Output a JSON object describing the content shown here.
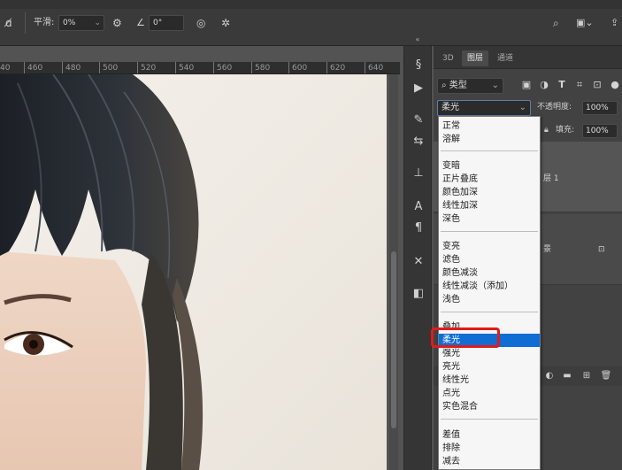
{
  "options_bar": {
    "smoothing_label": "平滑:",
    "smoothing_value": "0%",
    "angle_value": "0°"
  },
  "ruler": {
    "ticks": [
      "40",
      "460",
      "480",
      "500",
      "520",
      "540",
      "560",
      "580",
      "600",
      "620",
      "640"
    ]
  },
  "panel": {
    "tabs": [
      "3D",
      "图层",
      "通道"
    ],
    "filter_label": "类型",
    "blend_mode": "柔光",
    "opacity_label": "不透明度:",
    "opacity_value": "100%",
    "fill_label": "填充:",
    "fill_value": "100%",
    "layer1_name_partial": "层 1",
    "layer2_name_partial": "景"
  },
  "blend_menu": {
    "groups": [
      [
        "正常",
        "溶解"
      ],
      [
        "变暗",
        "正片叠底",
        "颜色加深",
        "线性加深",
        "深色"
      ],
      [
        "变亮",
        "滤色",
        "颜色减淡",
        "线性减淡（添加）",
        "浅色"
      ],
      [
        "叠加",
        "柔光",
        "强光",
        "亮光",
        "线性光",
        "点光",
        "实色混合"
      ],
      [
        "差值",
        "排除",
        "减去"
      ]
    ],
    "selected": "柔光"
  },
  "colors": {
    "selected_bg": "#0f6dd4",
    "highlight_border": "#e21a1a"
  }
}
